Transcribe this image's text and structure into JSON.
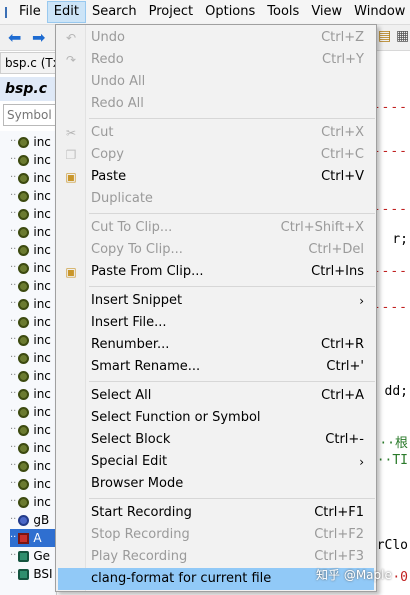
{
  "menubar": {
    "items": [
      "File",
      "Edit",
      "Search",
      "Project",
      "Options",
      "Tools",
      "View",
      "Window"
    ]
  },
  "tab": {
    "label": "bsp.c (Tx"
  },
  "panel": {
    "title": "bsp.c",
    "symbol_placeholder": "Symbol",
    "rows": [
      "inc",
      "inc",
      "inc",
      "inc",
      "inc",
      "inc",
      "inc",
      "inc",
      "inc",
      "inc",
      "inc",
      "inc",
      "inc",
      "inc",
      "inc",
      "inc",
      "inc",
      "inc",
      "inc",
      "inc",
      "inc",
      "gB",
      "A",
      "Ge",
      "BSI"
    ]
  },
  "editor": {
    "fragments": [
      "r;",
      "dd;",
      "··根",
      "··TI",
      "rClo",
      "·0"
    ]
  },
  "edit_menu": {
    "items": [
      {
        "label": "Undo",
        "shortcut": "Ctrl+Z",
        "enabled": false
      },
      {
        "label": "Redo",
        "shortcut": "Ctrl+Y",
        "enabled": false
      },
      {
        "label": "Undo All",
        "shortcut": "",
        "enabled": false
      },
      {
        "label": "Redo All",
        "shortcut": "",
        "enabled": false
      },
      {
        "label": "Cut",
        "shortcut": "Ctrl+X",
        "enabled": false
      },
      {
        "label": "Copy",
        "shortcut": "Ctrl+C",
        "enabled": false
      },
      {
        "label": "Paste",
        "shortcut": "Ctrl+V",
        "enabled": true
      },
      {
        "label": "Duplicate",
        "shortcut": "",
        "enabled": false
      },
      {
        "label": "Cut To Clip...",
        "shortcut": "Ctrl+Shift+X",
        "enabled": false
      },
      {
        "label": "Copy To Clip...",
        "shortcut": "Ctrl+Del",
        "enabled": false
      },
      {
        "label": "Paste From Clip...",
        "shortcut": "Ctrl+Ins",
        "enabled": true
      },
      {
        "label": "Insert Snippet",
        "shortcut": "",
        "enabled": true,
        "submenu": true
      },
      {
        "label": "Insert File...",
        "shortcut": "",
        "enabled": true
      },
      {
        "label": "Renumber...",
        "shortcut": "Ctrl+R",
        "enabled": true
      },
      {
        "label": "Smart Rename...",
        "shortcut": "Ctrl+'",
        "enabled": true
      },
      {
        "label": "Select All",
        "shortcut": "Ctrl+A",
        "enabled": true
      },
      {
        "label": "Select Function or Symbol",
        "shortcut": "",
        "enabled": true
      },
      {
        "label": "Select Block",
        "shortcut": "Ctrl+-",
        "enabled": true
      },
      {
        "label": "Special Edit",
        "shortcut": "",
        "enabled": true,
        "submenu": true
      },
      {
        "label": "Browser Mode",
        "shortcut": "",
        "enabled": true
      },
      {
        "label": "Start Recording",
        "shortcut": "Ctrl+F1",
        "enabled": true
      },
      {
        "label": "Stop Recording",
        "shortcut": "Ctrl+F2",
        "enabled": false
      },
      {
        "label": "Play Recording",
        "shortcut": "Ctrl+F3",
        "enabled": false
      },
      {
        "label": "clang-format for current file",
        "shortcut": "",
        "enabled": true,
        "highlighted": true
      }
    ],
    "submenu_arrow": "›"
  },
  "watermark": "知乎 @Maple",
  "colors": {
    "highlight": "#91c9f7",
    "menubar_active": "#cce4f7",
    "selected_row": "#2f6fd0",
    "disabled_text": "#9a9a9a"
  }
}
